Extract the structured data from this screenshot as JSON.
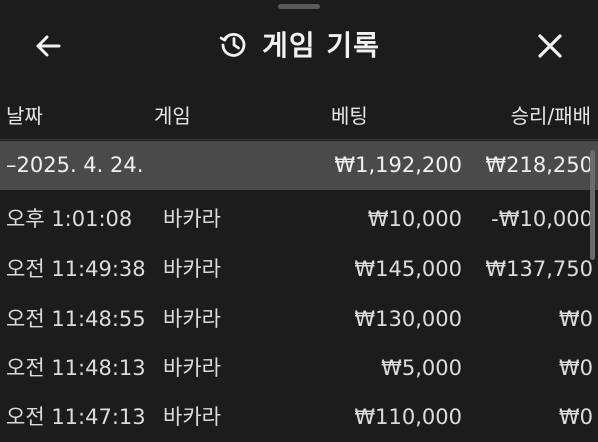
{
  "header": {
    "title": "게임 기록",
    "back_icon": "arrow-left-icon",
    "history_icon": "history-icon",
    "close_icon": "close-icon"
  },
  "columns": {
    "date": "날짜",
    "game": "게임",
    "bet": "베팅",
    "result": "승리/패배"
  },
  "date_group": {
    "date": "–2025. 4. 24.",
    "total_bet": "₩1,192,200",
    "total_result": "₩218,250"
  },
  "rows": [
    {
      "time": "오후 1:01:08",
      "game": "바카라",
      "bet": "₩10,000",
      "result": "-₩10,000"
    },
    {
      "time": "오전 11:49:38",
      "game": "바카라",
      "bet": "₩145,000",
      "result": "₩137,750"
    },
    {
      "time": "오전 11:48:55",
      "game": "바카라",
      "bet": "₩130,000",
      "result": "₩0"
    },
    {
      "time": "오전 11:48:13",
      "game": "바카라",
      "bet": "₩5,000",
      "result": "₩0"
    },
    {
      "time": "오전 11:47:13",
      "game": "바카라",
      "bet": "₩110,000",
      "result": "₩0"
    }
  ],
  "colors": {
    "background": "#1c1c1c",
    "date_row": "#4a4a4a",
    "text": "#ececec"
  }
}
